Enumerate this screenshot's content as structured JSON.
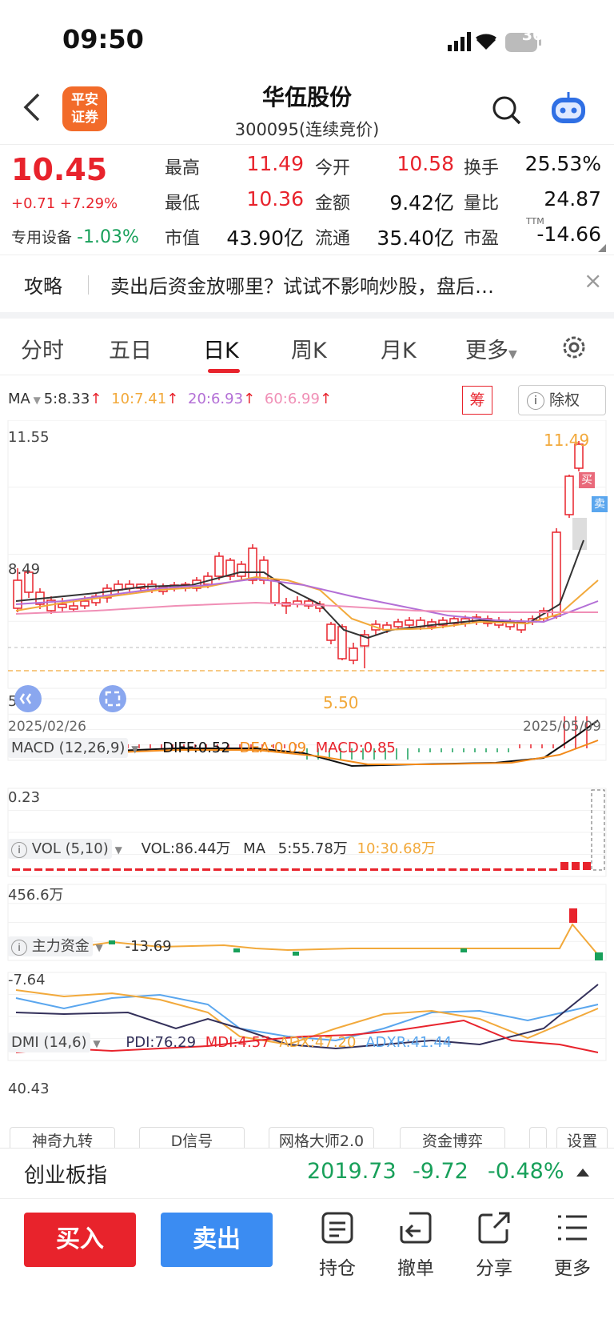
{
  "status_bar": {
    "time": "09:50",
    "battery": "36"
  },
  "header": {
    "stock_name": "华伍股份",
    "stock_code": "300095(连续竞价)",
    "logo_text_1": "平安",
    "logo_text_2": "证券"
  },
  "quote": {
    "price": "10.45",
    "change": "+0.71 +7.29%",
    "sector_name": "专用设备",
    "sector_change": "-1.03%",
    "items": [
      {
        "label": "最高",
        "value": "11.49"
      },
      {
        "label": "今开",
        "value": "10.58"
      },
      {
        "label": "换手",
        "value": "25.53%"
      },
      {
        "label": "最低",
        "value": "10.36"
      },
      {
        "label": "金额",
        "value": "9.42亿"
      },
      {
        "label": "量比",
        "value": "24.87"
      },
      {
        "label": "市值",
        "value": "43.90亿"
      },
      {
        "label": "流通",
        "value": "35.40亿"
      },
      {
        "label": "市盈",
        "value": "-14.66"
      }
    ],
    "ttm": "TTM"
  },
  "banner": {
    "tag": "攻略",
    "text": "卖出后资金放哪里？试试不影响炒股，盘后…",
    "close": "×"
  },
  "tabs": [
    "分时",
    "五日",
    "日K",
    "周K",
    "月K",
    "更多"
  ],
  "ma_line": {
    "label": "MA",
    "ma5": "5:8.33",
    "ma10": "10:7.41",
    "ma20": "20:6.93",
    "ma60": "60:6.99",
    "chou": "筹",
    "chuquan": "除权"
  },
  "kline": {
    "y_top": "11.55",
    "y_mid": "8.49",
    "y_low": "5.24",
    "low_mark": "5.50",
    "high_mark": "11.49",
    "date_start": "2025/02/26",
    "date_end": "2025/05/09",
    "buy_tag": "买",
    "sell_tag": "卖"
  },
  "macd": {
    "name": "MACD (12,26,9)",
    "diff": "DIFF:0.52",
    "dea": "DEA:0.09",
    "macd": "MACD:0.85",
    "axis": "0.23"
  },
  "vol": {
    "name": "VOL (5,10)",
    "vol": "VOL:86.44万",
    "ma": "MA",
    "ma5": "5:55.78万",
    "ma10": "10:30.68万",
    "axis": "456.6万"
  },
  "funds": {
    "name": "主力资金",
    "value": "-13.69",
    "axis": "-7.64"
  },
  "dmi": {
    "name": "DMI (14,6)",
    "pdi": "PDI:76.29",
    "mdi": "MDI:4.57",
    "adx": "ADX:47.20",
    "adxr": "ADXR:41.44",
    "axis": "40.43"
  },
  "bottom_tabs": [
    "神奇九转",
    "D信号",
    "网格大师2.0",
    "资金博弈",
    "设置"
  ],
  "index": {
    "name": "创业板指",
    "value": "2019.73",
    "change": "-9.72",
    "pct": "-0.48%"
  },
  "actions": {
    "buy": "买入",
    "sell": "卖出",
    "items": [
      "持仓",
      "撤单",
      "分享",
      "更多"
    ]
  },
  "colors": {
    "up": "#e8232c",
    "down": "#18a05a",
    "ma5": "#333333",
    "ma10": "#f2a93b",
    "ma20": "#b36fd6",
    "ma60": "#f08fb6",
    "blue": "#3b8cf2"
  }
}
